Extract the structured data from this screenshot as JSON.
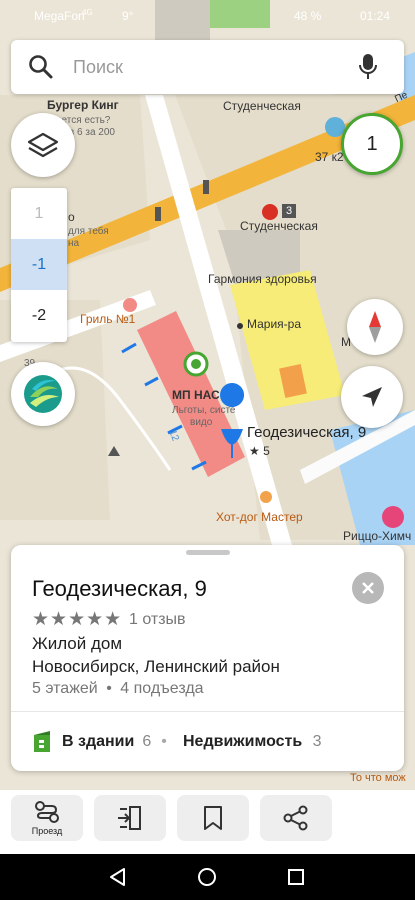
{
  "status_bar": {
    "carrier": "MegaFon",
    "net": "4G",
    "temp": "9°",
    "battery": "48 %",
    "time": "01:24"
  },
  "search": {
    "placeholder": "Поиск"
  },
  "cluster_badge": "1",
  "floors": [
    "1",
    "-1",
    "-2"
  ],
  "map_labels": {
    "burger_king": "Бургер Кинг",
    "burger_sub1": "ается есть?",
    "burger_sub2": "ка в 6 за 200",
    "studencheskaya_top": "Студенческая",
    "studencheskaya_metro": "Студенческая",
    "metro_line": "3",
    "house_37": "37 к2",
    "harmony": "Гармония здоровья",
    "maria_ra": "Мария-ра",
    "grill": "Гриль №1",
    "mp_nas": "МП НАС",
    "mp_sub1": "Льготы, систе",
    "mp_sub2": "видо",
    "geo": "Геодезическая, 9",
    "geo_rating": "★ 5",
    "hotdog": "Хот-дог Мастер",
    "rizzo": "Риццо-Химч",
    "left_cut1": "о",
    "left_cut2": "для тебя",
    "left_cut3": "на",
    "mc": "М",
    "road_top": "Пе",
    "bottom_cut": "То что мож",
    "num_39": "39",
    "r12": "12"
  },
  "card": {
    "title": "Геодезическая, 9",
    "stars": "★★★★★",
    "reviews": "1 отзыв",
    "type": "Жилой дом",
    "location": "Новосибирск, Ленинский район",
    "floors": "5 этажей",
    "entrances": "4 подъезда",
    "in_building_label": "В здании",
    "in_building_count": "6",
    "realty_label": "Недвижимость",
    "realty_count": "3"
  },
  "toolbar": {
    "route_label": "Проезд"
  },
  "colors": {
    "accent": "#1a73c8",
    "pin": "#1e78e6",
    "building": "#f28b86",
    "mall": "#f6ec77",
    "green": "#47a531",
    "road": "#f2b43a"
  },
  "icons": [
    "search-icon",
    "mic-icon",
    "layers-icon",
    "compass-icon",
    "location-arrow-icon",
    "route-icon",
    "route-list-icon",
    "bookmark-icon",
    "share-icon",
    "close-icon",
    "building-icon",
    "back-icon",
    "home-icon",
    "recents-icon"
  ]
}
